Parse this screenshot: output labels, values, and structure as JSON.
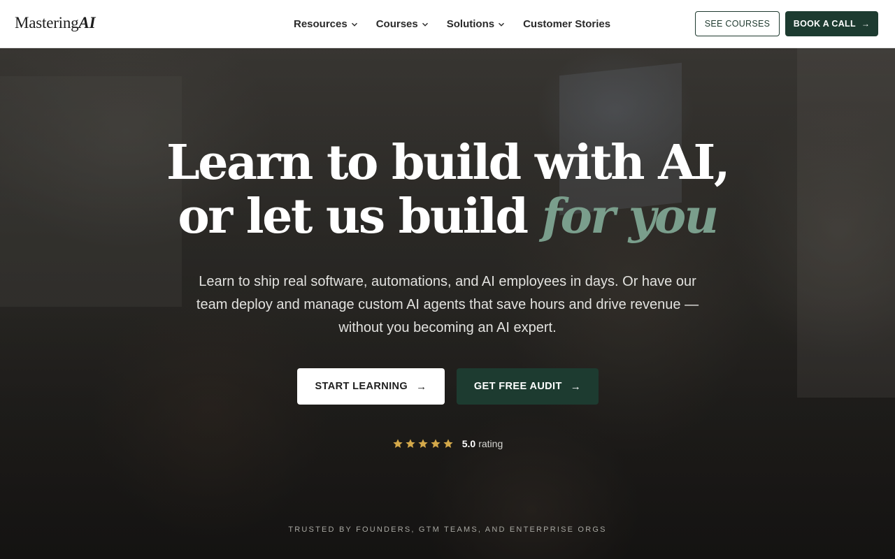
{
  "brand": {
    "logo_main": "Mastering",
    "logo_accent": "AI"
  },
  "nav": {
    "items": [
      {
        "label": "Resources",
        "has_dropdown": true,
        "icon": "chevron-down-icon"
      },
      {
        "label": "Courses",
        "has_dropdown": true,
        "icon": "chevron-down-icon"
      },
      {
        "label": "Solutions",
        "has_dropdown": true,
        "icon": "chevron-down-icon"
      },
      {
        "label": "Customer Stories",
        "has_dropdown": false
      }
    ],
    "see_courses_label": "SEE COURSES",
    "book_call_label": "BOOK A CALL",
    "arrow_icon": "arrow-right-icon"
  },
  "hero": {
    "headline_line1": "Learn to build with AI,",
    "headline_line2_prefix": "or let us build",
    "headline_line2_accent": "for you",
    "subheadline": "Learn to ship real software, automations, and AI employees in days. Or have our team deploy and manage custom AI agents that save hours and drive revenue — without you becoming an AI expert.",
    "primary_cta": "START LEARNING",
    "secondary_cta": "GET FREE AUDIT",
    "rating": {
      "stars": 5,
      "value": "5.0",
      "label": "rating"
    },
    "trusted_by": "TRUSTED BY FOUNDERS, GTM TEAMS, AND ENTERPRISE ORGS"
  },
  "colors": {
    "brand_dark_green": "#1d3b30",
    "accent_sage": "#7a9e8c",
    "star_gold": "#d4a94a",
    "nav_bg": "#ffffff"
  }
}
